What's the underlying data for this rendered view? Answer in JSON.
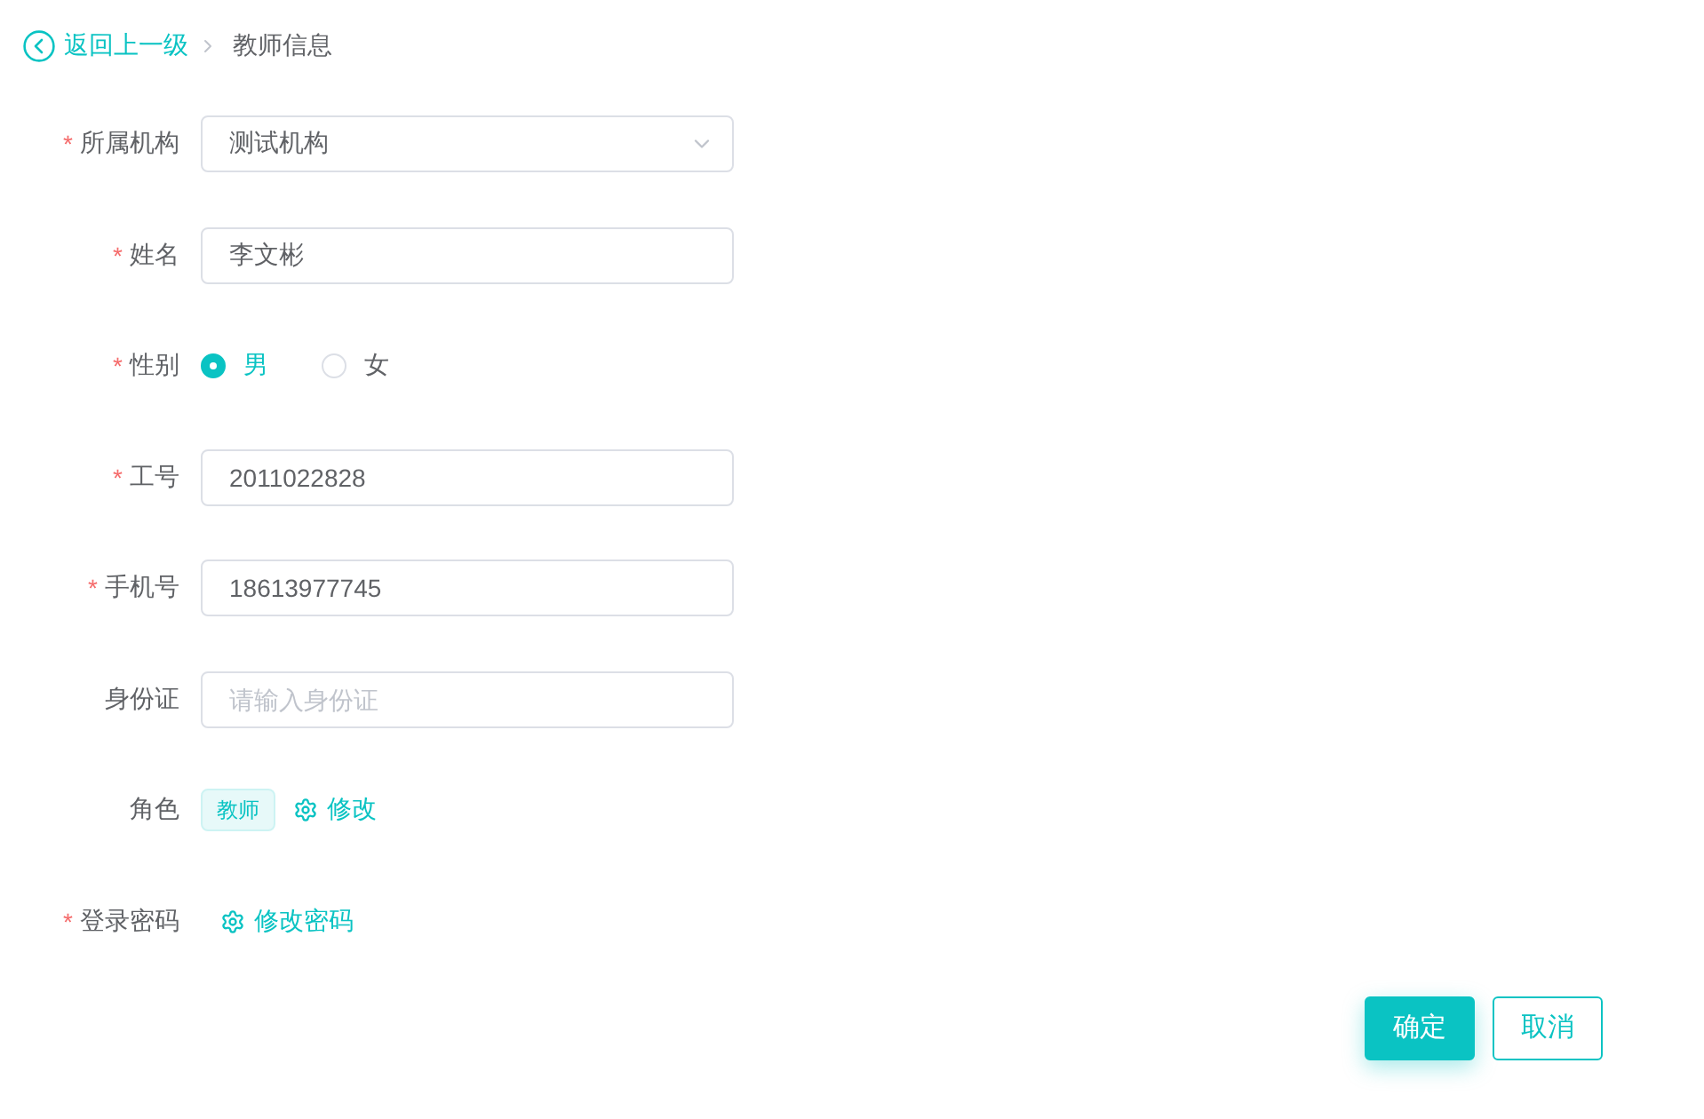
{
  "breadcrumb": {
    "back": "返回上一级",
    "current": "教师信息"
  },
  "form": {
    "required_mark": "*",
    "fields": [
      {
        "kind": "select",
        "label": "所属机构",
        "required": true,
        "value": "测试机构"
      },
      {
        "kind": "input",
        "label": "姓名",
        "required": true,
        "value": "李文彬"
      },
      {
        "kind": "radio",
        "label": "性别",
        "required": true,
        "options": [
          {
            "label": "男",
            "selected": true
          },
          {
            "label": "女",
            "selected": false
          }
        ]
      },
      {
        "kind": "input",
        "label": "工号",
        "required": true,
        "value": "2011022828"
      },
      {
        "kind": "input",
        "label": "手机号",
        "required": true,
        "value": "18613977745"
      },
      {
        "kind": "input",
        "label": "身份证",
        "required": false,
        "placeholder": "请输入身份证"
      },
      {
        "kind": "tags",
        "label": "角色",
        "required": false,
        "tags": [
          "教师"
        ],
        "action": "修改"
      },
      {
        "kind": "action",
        "label": "登录密码",
        "required": true,
        "action": "修改密码"
      }
    ]
  },
  "buttons": [
    {
      "kind": "primary",
      "label": "确定"
    },
    {
      "kind": "secondary",
      "label": "取消"
    }
  ]
}
